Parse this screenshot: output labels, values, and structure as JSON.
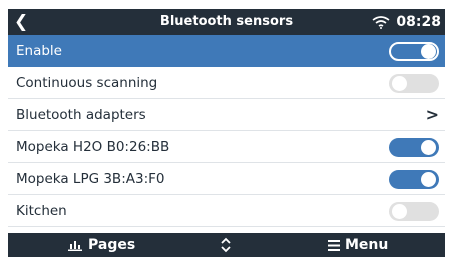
{
  "header": {
    "back_icon": "chevron-left-icon",
    "title": "Bluetooth sensors",
    "wifi_icon": "wifi-icon",
    "time": "08:28"
  },
  "list": {
    "items": [
      {
        "label": "Enable",
        "control": "toggle",
        "state": "on",
        "selected": true
      },
      {
        "label": "Continuous scanning",
        "control": "toggle",
        "state": "off"
      },
      {
        "label": "Bluetooth adapters",
        "control": "chevron",
        "icon": "chevron-right-icon",
        "glyph": ">"
      },
      {
        "label": "Mopeka H2O B0:26:BB",
        "control": "toggle",
        "state": "on"
      },
      {
        "label": "Mopeka LPG 3B:A3:F0",
        "control": "toggle",
        "state": "on"
      },
      {
        "label": "Kitchen",
        "control": "toggle",
        "state": "off"
      }
    ]
  },
  "footer": {
    "pages_label": "Pages",
    "pages_icon": "bar-chart-icon",
    "updown_icon": "up-down-icon",
    "menu_label": "Menu",
    "menu_icon": "hamburger-icon"
  },
  "colors": {
    "bar": "#242f3a",
    "accent": "#3f79b8",
    "toggle_off": "#e0e0e0",
    "text": "#242f3a"
  }
}
